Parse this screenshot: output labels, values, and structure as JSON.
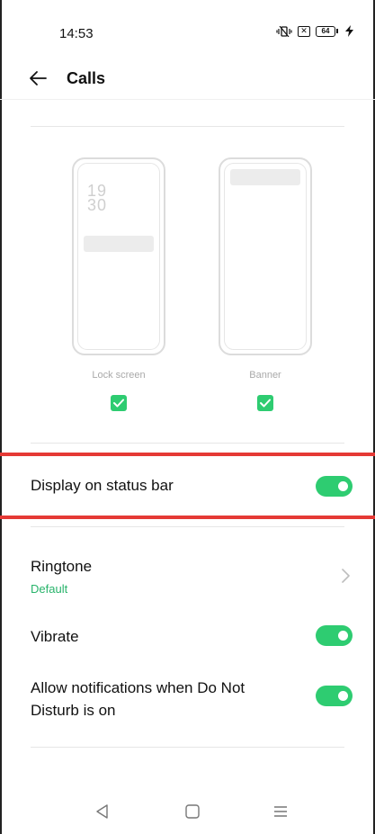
{
  "status_bar": {
    "time": "14:53",
    "battery_level": "64",
    "icons": [
      "vibrate-icon",
      "no-sim-icon",
      "battery-icon",
      "charging-icon"
    ]
  },
  "header": {
    "title": "Calls",
    "back_icon": "arrow-left-icon"
  },
  "notification_styles": {
    "lock_screen": {
      "label": "Lock screen",
      "checked": true,
      "clock_hours": "19",
      "clock_minutes": "30"
    },
    "banner": {
      "label": "Banner",
      "checked": true
    }
  },
  "settings": {
    "display_on_status_bar": {
      "label": "Display on status bar",
      "enabled": true
    },
    "ringtone": {
      "label": "Ringtone",
      "value": "Default"
    },
    "vibrate": {
      "label": "Vibrate",
      "enabled": true
    },
    "allow_dnd": {
      "label_line1": "Allow notifications when Do Not",
      "label_line2": "Disturb is on",
      "enabled": true
    }
  },
  "colors": {
    "accent_green": "#2ecc71",
    "subtitle_green": "#27b36a",
    "highlight_red": "#e53935"
  },
  "nav_bar": {
    "icons": [
      "back-triangle-icon",
      "home-square-icon",
      "menu-lines-icon"
    ]
  }
}
